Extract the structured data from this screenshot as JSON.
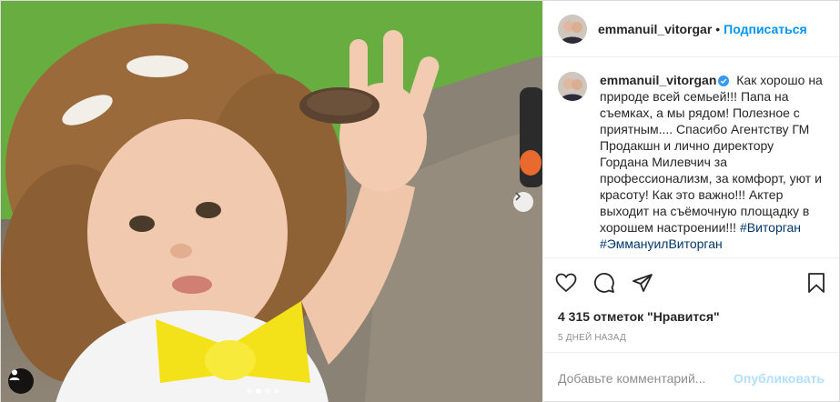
{
  "header": {
    "username": "emmanuil_vitorgar",
    "separator": "•",
    "follow_label": "Подписаться"
  },
  "caption": {
    "username": "emmanuil_vitorgan",
    "text": "Как хорошо на природе всей семьей!!! Папа на съемках, а мы рядом! Полезное с приятным.... Спасибо Агентству ГМ Продакшн и лично директору Гордана Милевчич за профессионализм, за комфорт, уют и красоту! Как это важно!!! Актер выходит на съёмочную площадку в хорошем настроении!!!",
    "hashtag1": "#Виторган",
    "hashtag2": "#ЭммануилВиторган"
  },
  "actions": {
    "like_icon": "heart-icon",
    "comment_icon": "comment-icon",
    "share_icon": "share-icon",
    "save_icon": "bookmark-icon"
  },
  "likes": "4 315 отметок \"Нравится\"",
  "date": "5 дней назад",
  "comment_box": {
    "placeholder": "Добавьте комментарий...",
    "publish_label": "Опубликовать"
  },
  "carousel": {
    "slides": 4,
    "active_index": 1
  },
  "colors": {
    "accent": "#0095f6",
    "publish_disabled": "#b2dffc",
    "hashtag": "#00376b",
    "border": "#dbdbdb"
  }
}
